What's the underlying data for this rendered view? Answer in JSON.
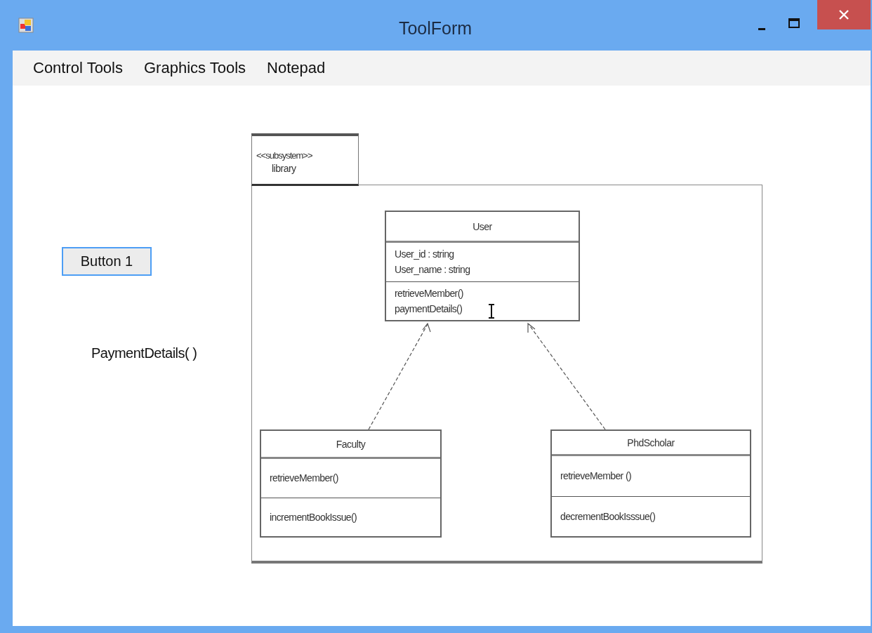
{
  "window": {
    "title": "ToolForm"
  },
  "menu": [
    {
      "label": "Control Tools"
    },
    {
      "label": "Graphics Tools"
    },
    {
      "label": "Notepad"
    }
  ],
  "button": {
    "label": "Button 1",
    "focused": true
  },
  "label": {
    "text": "PaymentDetails( )"
  },
  "diagram": {
    "stereotype": "<<subsystem>>",
    "package": "library",
    "classes": [
      {
        "name": "User",
        "sections": [
          [
            "User_id : string",
            "User_name : string"
          ],
          [
            "retrieveMember()",
            "paymentDetails()"
          ]
        ]
      },
      {
        "name": "Faculty",
        "sections": [
          [
            "retrieveMember()"
          ],
          [
            "incrementBookIssue()"
          ]
        ]
      },
      {
        "name": "PhdScholar",
        "sections": [
          [
            "retrieveMember ()"
          ],
          [
            "decrementBookIsssue()"
          ]
        ]
      }
    ]
  }
}
